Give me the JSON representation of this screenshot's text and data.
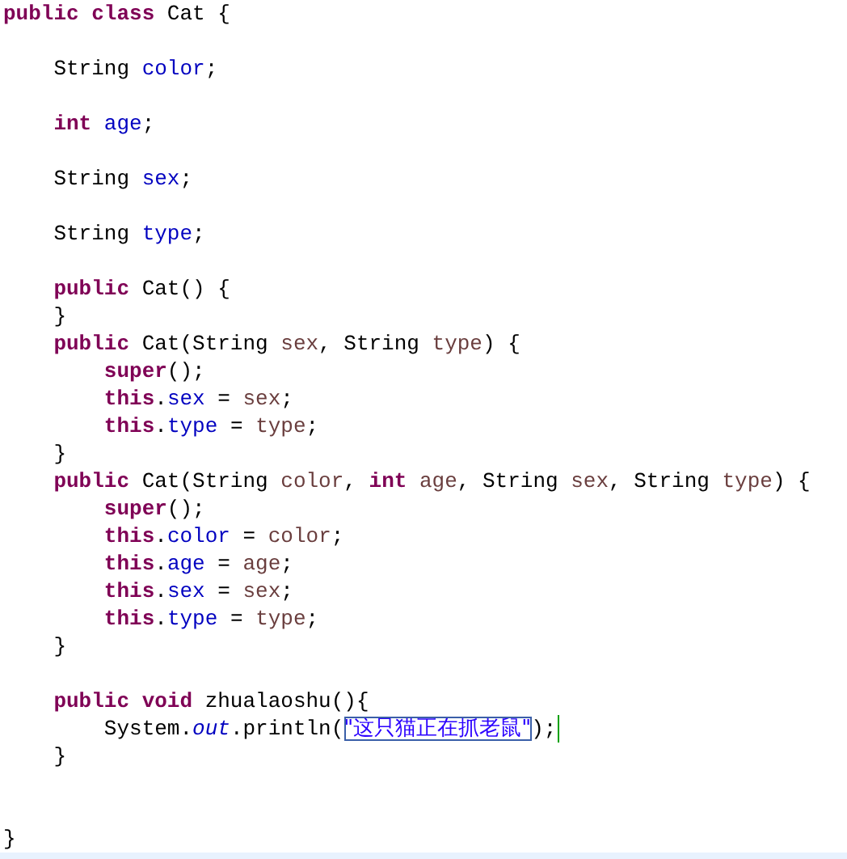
{
  "editor": {
    "lines": [
      {
        "kind": "code",
        "caret": false,
        "tokens": [
          {
            "text": "public class",
            "kind": "keyword"
          },
          {
            "text": " Cat {",
            "kind": "plain"
          }
        ]
      },
      {
        "kind": "blank"
      },
      {
        "kind": "code",
        "caret": false,
        "tokens": [
          {
            "text": "    String ",
            "kind": "plain"
          },
          {
            "text": "color",
            "kind": "field"
          },
          {
            "text": ";",
            "kind": "plain"
          }
        ]
      },
      {
        "kind": "blank"
      },
      {
        "kind": "code",
        "caret": false,
        "tokens": [
          {
            "text": "    int",
            "kind": "keyword"
          },
          {
            "text": " age",
            "kind": "field"
          },
          {
            "text": ";",
            "kind": "plain"
          }
        ]
      },
      {
        "kind": "blank"
      },
      {
        "kind": "code",
        "caret": false,
        "tokens": [
          {
            "text": "    String ",
            "kind": "plain"
          },
          {
            "text": "sex",
            "kind": "field"
          },
          {
            "text": ";",
            "kind": "plain"
          }
        ]
      },
      {
        "kind": "blank"
      },
      {
        "kind": "code",
        "caret": false,
        "tokens": [
          {
            "text": "    String ",
            "kind": "plain"
          },
          {
            "text": "type",
            "kind": "field"
          },
          {
            "text": ";",
            "kind": "plain"
          }
        ]
      },
      {
        "kind": "blank"
      },
      {
        "kind": "code",
        "caret": false,
        "tokens": [
          {
            "text": "    public",
            "kind": "keyword"
          },
          {
            "text": " Cat() {",
            "kind": "plain"
          }
        ]
      },
      {
        "kind": "code",
        "caret": false,
        "tokens": [
          {
            "text": "    }",
            "kind": "plain"
          }
        ]
      },
      {
        "kind": "code",
        "caret": false,
        "tokens": [
          {
            "text": "    public",
            "kind": "keyword"
          },
          {
            "text": " Cat(String ",
            "kind": "plain"
          },
          {
            "text": "sex",
            "kind": "local"
          },
          {
            "text": ", String ",
            "kind": "plain"
          },
          {
            "text": "type",
            "kind": "local"
          },
          {
            "text": ") {",
            "kind": "plain"
          }
        ]
      },
      {
        "kind": "code",
        "caret": false,
        "tokens": [
          {
            "text": "        super",
            "kind": "keyword"
          },
          {
            "text": "();",
            "kind": "plain"
          }
        ]
      },
      {
        "kind": "code",
        "caret": false,
        "tokens": [
          {
            "text": "        this",
            "kind": "keyword"
          },
          {
            "text": ".",
            "kind": "plain"
          },
          {
            "text": "sex",
            "kind": "field"
          },
          {
            "text": " = ",
            "kind": "plain"
          },
          {
            "text": "sex",
            "kind": "local"
          },
          {
            "text": ";",
            "kind": "plain"
          }
        ]
      },
      {
        "kind": "code",
        "caret": false,
        "tokens": [
          {
            "text": "        this",
            "kind": "keyword"
          },
          {
            "text": ".",
            "kind": "plain"
          },
          {
            "text": "type",
            "kind": "field"
          },
          {
            "text": " = ",
            "kind": "plain"
          },
          {
            "text": "type",
            "kind": "local"
          },
          {
            "text": ";",
            "kind": "plain"
          }
        ]
      },
      {
        "kind": "code",
        "caret": false,
        "tokens": [
          {
            "text": "    }",
            "kind": "plain"
          }
        ]
      },
      {
        "kind": "code",
        "caret": false,
        "tokens": [
          {
            "text": "    public",
            "kind": "keyword"
          },
          {
            "text": " Cat(String ",
            "kind": "plain"
          },
          {
            "text": "color",
            "kind": "local"
          },
          {
            "text": ", ",
            "kind": "plain"
          },
          {
            "text": "int",
            "kind": "keyword"
          },
          {
            "text": " age",
            "kind": "local"
          },
          {
            "text": ", String ",
            "kind": "plain"
          },
          {
            "text": "sex",
            "kind": "local"
          },
          {
            "text": ", String ",
            "kind": "plain"
          },
          {
            "text": "type",
            "kind": "local"
          },
          {
            "text": ") {",
            "kind": "plain"
          }
        ]
      },
      {
        "kind": "code",
        "caret": false,
        "tokens": [
          {
            "text": "        super",
            "kind": "keyword"
          },
          {
            "text": "();",
            "kind": "plain"
          }
        ]
      },
      {
        "kind": "code",
        "caret": false,
        "tokens": [
          {
            "text": "        this",
            "kind": "keyword"
          },
          {
            "text": ".",
            "kind": "plain"
          },
          {
            "text": "color",
            "kind": "field"
          },
          {
            "text": " = ",
            "kind": "plain"
          },
          {
            "text": "color",
            "kind": "local"
          },
          {
            "text": ";",
            "kind": "plain"
          }
        ]
      },
      {
        "kind": "code",
        "caret": false,
        "tokens": [
          {
            "text": "        this",
            "kind": "keyword"
          },
          {
            "text": ".",
            "kind": "plain"
          },
          {
            "text": "age",
            "kind": "field"
          },
          {
            "text": " = ",
            "kind": "plain"
          },
          {
            "text": "age",
            "kind": "local"
          },
          {
            "text": ";",
            "kind": "plain"
          }
        ]
      },
      {
        "kind": "code",
        "caret": false,
        "tokens": [
          {
            "text": "        this",
            "kind": "keyword"
          },
          {
            "text": ".",
            "kind": "plain"
          },
          {
            "text": "sex",
            "kind": "field"
          },
          {
            "text": " = ",
            "kind": "plain"
          },
          {
            "text": "sex",
            "kind": "local"
          },
          {
            "text": ";",
            "kind": "plain"
          }
        ]
      },
      {
        "kind": "code",
        "caret": false,
        "tokens": [
          {
            "text": "        this",
            "kind": "keyword"
          },
          {
            "text": ".",
            "kind": "plain"
          },
          {
            "text": "type",
            "kind": "field"
          },
          {
            "text": " = ",
            "kind": "plain"
          },
          {
            "text": "type",
            "kind": "local"
          },
          {
            "text": ";",
            "kind": "plain"
          }
        ]
      },
      {
        "kind": "code",
        "caret": false,
        "tokens": [
          {
            "text": "    }",
            "kind": "plain"
          }
        ]
      },
      {
        "kind": "blank"
      },
      {
        "kind": "code",
        "caret": false,
        "tokens": [
          {
            "text": "    public void",
            "kind": "keyword"
          },
          {
            "text": " zhualaoshu(){",
            "kind": "plain"
          }
        ]
      },
      {
        "kind": "code",
        "caret": true,
        "tokens": [
          {
            "text": "        System.",
            "kind": "plain"
          },
          {
            "text": "out",
            "kind": "static"
          },
          {
            "text": ".println(",
            "kind": "plain"
          },
          {
            "text": "\"这只猫正在抓老鼠\"",
            "kind": "string",
            "boxed": true
          },
          {
            "text": ");",
            "kind": "plain"
          }
        ]
      },
      {
        "kind": "code",
        "caret": false,
        "tokens": [
          {
            "text": "    }",
            "kind": "plain"
          }
        ]
      },
      {
        "kind": "blank"
      },
      {
        "kind": "blank"
      },
      {
        "kind": "code",
        "caret": false,
        "tokens": [
          {
            "text": "}",
            "kind": "plain"
          }
        ]
      }
    ]
  }
}
